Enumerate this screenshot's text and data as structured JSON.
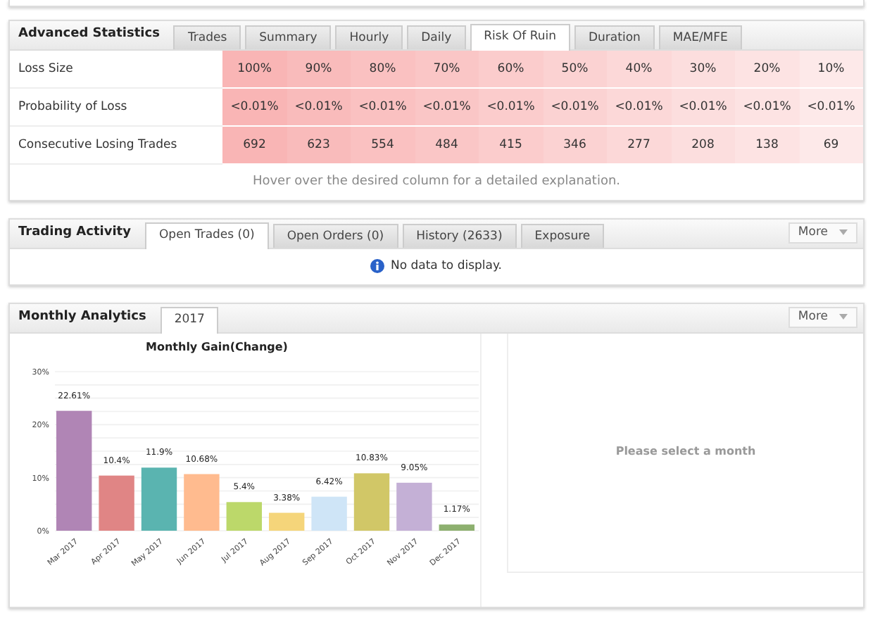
{
  "advanced_statistics": {
    "title": "Advanced Statistics",
    "tabs": [
      {
        "label": "Trades",
        "selected": false
      },
      {
        "label": "Summary",
        "selected": false
      },
      {
        "label": "Hourly",
        "selected": false
      },
      {
        "label": "Daily",
        "selected": false
      },
      {
        "label": "Risk Of Ruin",
        "selected": true
      },
      {
        "label": "Duration",
        "selected": false
      },
      {
        "label": "MAE/MFE",
        "selected": false
      }
    ],
    "columns": [
      {
        "color": "#f9b5b5"
      },
      {
        "color": "#f9bbbb"
      },
      {
        "color": "#fac1c1"
      },
      {
        "color": "#fac6c6"
      },
      {
        "color": "#fbcccc"
      },
      {
        "color": "#fbd2d2"
      },
      {
        "color": "#fcd8d8"
      },
      {
        "color": "#fcdede"
      },
      {
        "color": "#fde3e3"
      },
      {
        "color": "#fde9e9"
      }
    ],
    "rows": [
      {
        "label": "Loss Size",
        "cells": [
          "100%",
          "90%",
          "80%",
          "70%",
          "60%",
          "50%",
          "40%",
          "30%",
          "20%",
          "10%"
        ]
      },
      {
        "label": "Probability of Loss",
        "cells": [
          "<0.01%",
          "<0.01%",
          "<0.01%",
          "<0.01%",
          "<0.01%",
          "<0.01%",
          "<0.01%",
          "<0.01%",
          "<0.01%",
          "<0.01%"
        ]
      },
      {
        "label": "Consecutive Losing Trades",
        "cells": [
          "692",
          "623",
          "554",
          "484",
          "415",
          "346",
          "277",
          "208",
          "138",
          "69"
        ]
      }
    ],
    "hint": "Hover over the desired column for a detailed explanation."
  },
  "trading_activity": {
    "title": "Trading Activity",
    "tabs": [
      {
        "label": "Open Trades (0)",
        "selected": true
      },
      {
        "label": "Open Orders (0)",
        "selected": false
      },
      {
        "label": "History (2633)",
        "selected": false
      },
      {
        "label": "Exposure",
        "selected": false
      }
    ],
    "more_button": "More",
    "message": "No data to display."
  },
  "monthly_analytics": {
    "title": "Monthly Analytics",
    "tabs": [
      {
        "label": "2017",
        "selected": true
      }
    ],
    "more_button": "More",
    "placeholder_message": "Please select a month",
    "chart_data": {
      "type": "bar",
      "title": "Monthly Gain(Change)",
      "categories": [
        "Mar 2017",
        "Apr 2017",
        "May 2017",
        "Jun 2017",
        "Jul 2017",
        "Aug 2017",
        "Sep 2017",
        "Oct 2017",
        "Nov 2017",
        "Dec 2017"
      ],
      "series": [
        {
          "values": [
            22.61,
            10.4,
            11.9,
            10.68,
            5.4,
            3.38,
            6.42,
            10.83,
            9.05,
            1.17
          ]
        }
      ],
      "colors": [
        "#b085b5",
        "#e08585",
        "#5ab4b0",
        "#ffbb8f",
        "#bcd86a",
        "#f5d57a",
        "#cfe5f7",
        "#d1c767",
        "#c4b0d6",
        "#8db06f"
      ],
      "value_labels": [
        "22.61%",
        "10.4%",
        "11.9%",
        "10.68%",
        "5.4%",
        "3.38%",
        "6.42%",
        "10.83%",
        "9.05%",
        "1.17%"
      ],
      "ylim": [
        0,
        30
      ],
      "yticks": [
        {
          "value": 0,
          "label": "0%"
        },
        {
          "value": 10,
          "label": "10%"
        },
        {
          "value": 20,
          "label": "20%"
        },
        {
          "value": 30,
          "label": "30%"
        }
      ]
    }
  }
}
